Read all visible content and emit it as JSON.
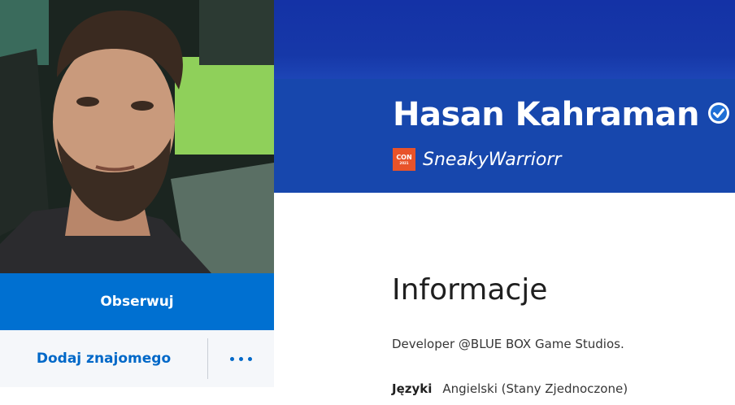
{
  "profile": {
    "display_name": "Hasan Kahraman",
    "online_id": "SneakyWarriorr",
    "avatar_badge_lines": [
      "CON",
      "2021"
    ]
  },
  "actions": {
    "follow": "Obserwuj",
    "add_friend": "Dodaj znajomego"
  },
  "about": {
    "title": "Informacje",
    "bio": "Developer @BLUE BOX Game Studios.",
    "languages_label": "Języki",
    "languages_value": "Angielski (Stany Zjednoczone)"
  },
  "icons": {
    "verified": "verified-check-icon",
    "plus": "playstation-plus-icon",
    "more": "more-dots-icon"
  },
  "colors": {
    "header_top": "#1432a6",
    "header_name": "#1747ad",
    "follow_button": "#0070d1",
    "link_blue": "#0068c8",
    "plus_gold": "#f3b21b"
  }
}
